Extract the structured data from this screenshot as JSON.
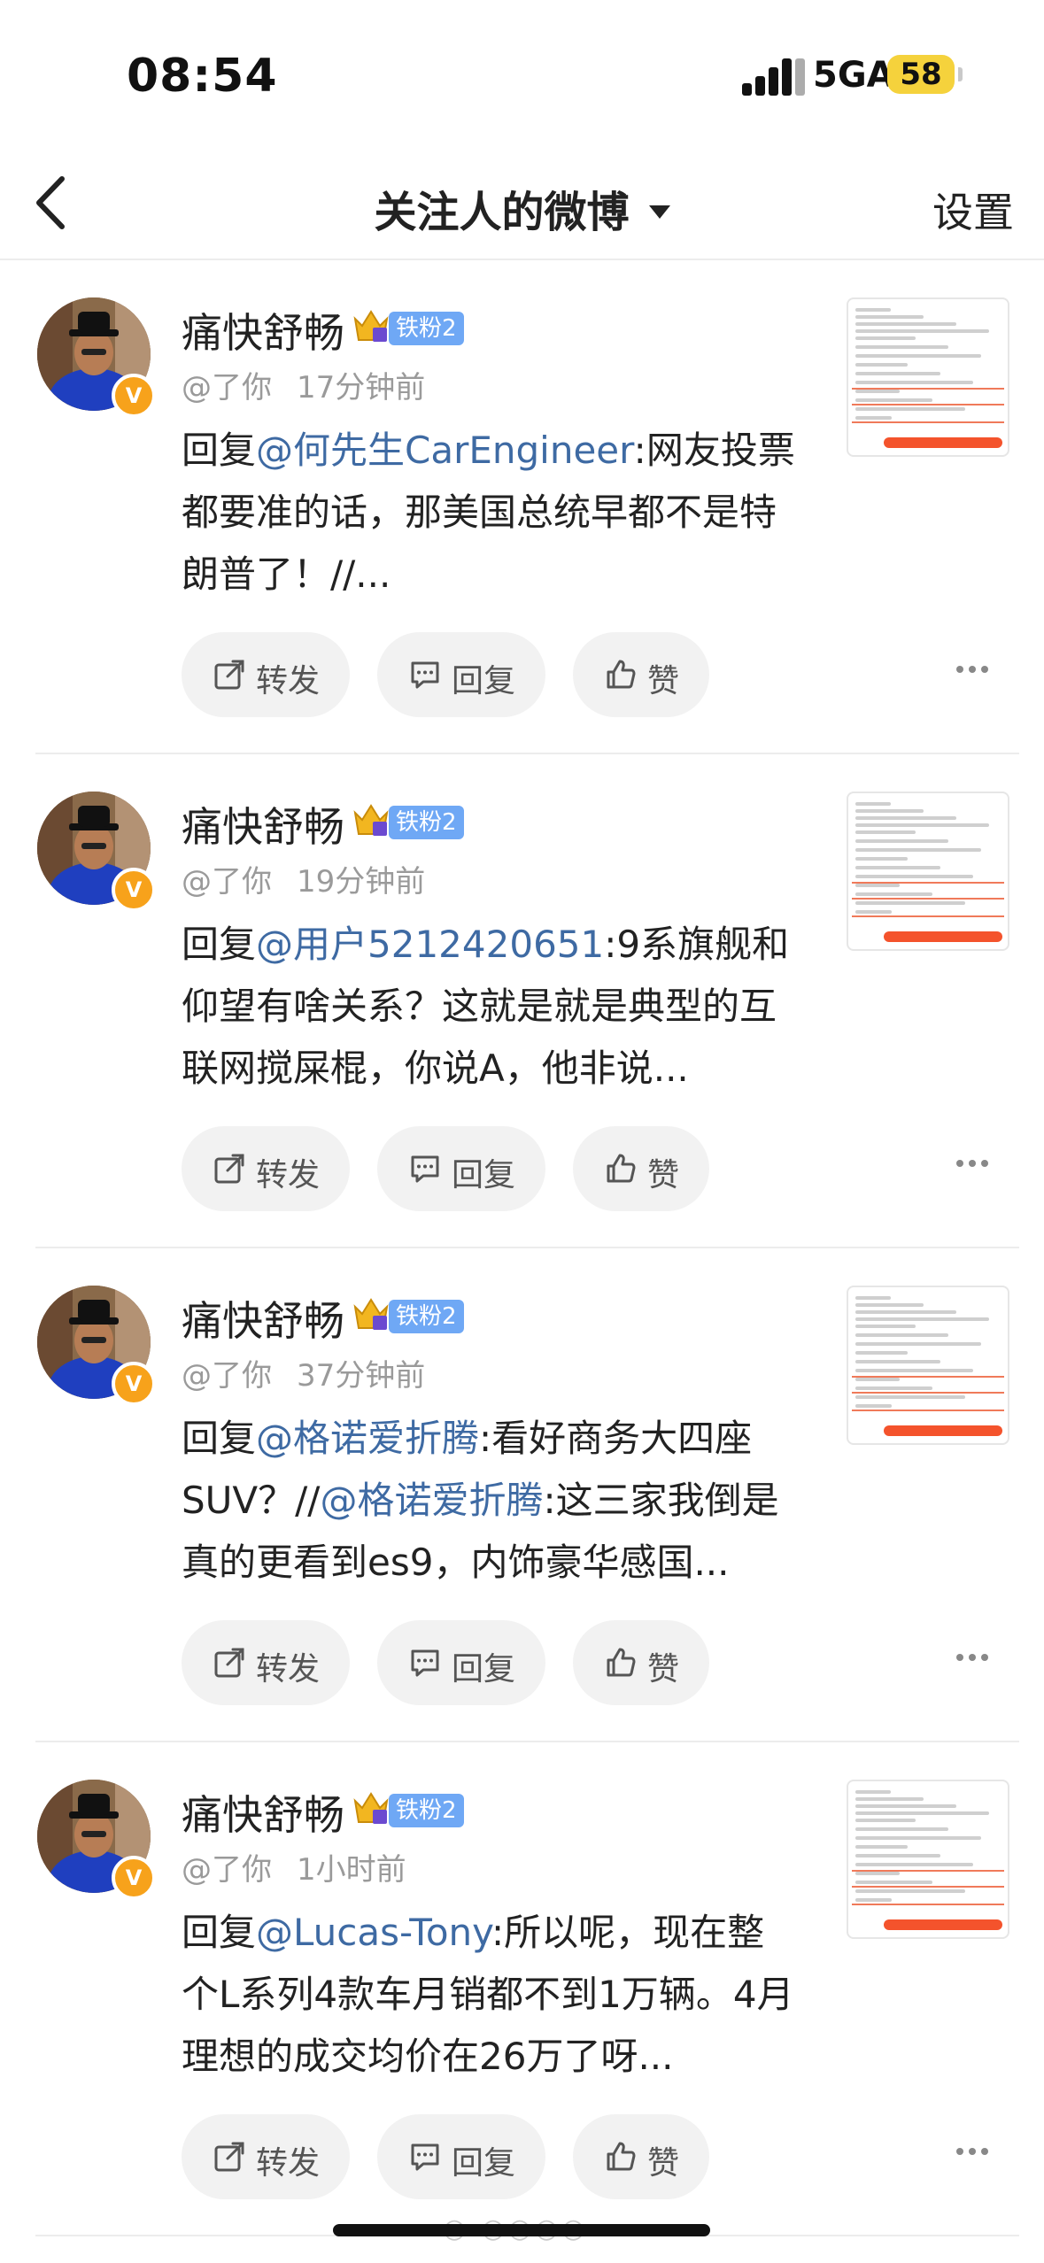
{
  "status_bar": {
    "time": "08:54",
    "network": "5GA",
    "battery": "58"
  },
  "nav": {
    "back_icon": "chevron-left-icon",
    "title": "关注人的微博",
    "settings": "设置"
  },
  "actions": {
    "repost": "转发",
    "reply": "回复",
    "like": "赞"
  },
  "posts": [
    {
      "name": "痛快舒畅",
      "fan_badge": "铁粉2",
      "to": "@了你",
      "time": "17分钟前",
      "prefix": "回复",
      "mention1": "@何先生CarEngineer",
      "rest1": ":网友投票都要准的话，那美国总统早都不是特朗普了！//...",
      "mention2": "",
      "rest2": ""
    },
    {
      "name": "痛快舒畅",
      "fan_badge": "铁粉2",
      "to": "@了你",
      "time": "19分钟前",
      "prefix": "回复",
      "mention1": "@用户5212420651",
      "rest1": ":9系旗舰和仰望有啥关系？这就是就是典型的互联网搅屎棍，你说A，他非说...",
      "mention2": "",
      "rest2": ""
    },
    {
      "name": "痛快舒畅",
      "fan_badge": "铁粉2",
      "to": "@了你",
      "time": "37分钟前",
      "prefix": "回复",
      "mention1": "@格诺爱折腾",
      "rest1": ":看好商务大四座SUV？//",
      "mention2": "@格诺爱折腾",
      "rest2": ":这三家我倒是真的更看到es9，内饰豪华感国..."
    },
    {
      "name": "痛快舒畅",
      "fan_badge": "铁粉2",
      "to": "@了你",
      "time": "1小时前",
      "prefix": "回复",
      "mention1": "@Lucas-Tony",
      "rest1": ":所以呢，现在整个L系列4款车月销都不到1万辆。4月理想的成交均价在26万了呀...",
      "mention2": "",
      "rest2": ""
    }
  ],
  "colors": {
    "mention": "#3e6aa3",
    "fan_badge": "#6fa8f5",
    "verified": "#f7a21b",
    "battery": "#f5d23c"
  }
}
